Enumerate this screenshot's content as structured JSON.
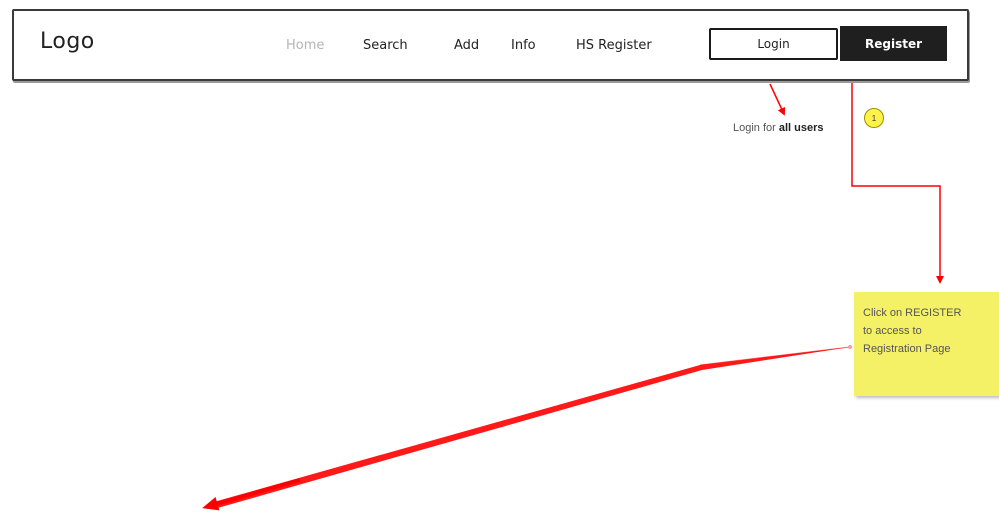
{
  "navbar": {
    "logo": "Logo",
    "items": [
      {
        "label": "Home",
        "active": true
      },
      {
        "label": "Search",
        "active": false
      },
      {
        "label": "Add",
        "active": false
      },
      {
        "label": "Info",
        "active": false
      },
      {
        "label": "HS Register",
        "active": false
      }
    ],
    "login_button": "Login",
    "register_button": "Register"
  },
  "annotations": {
    "login_note_prefix": "Login for ",
    "login_note_bold": "all users",
    "step_number": "1",
    "sticky_lines": [
      "Click on REGISTER",
      "to access to",
      "Registration Page"
    ]
  },
  "colors": {
    "arrow": "#ff0000",
    "sticky": "#f4f166",
    "badge": "#fff34a",
    "register_button": "#1f1f1f"
  }
}
